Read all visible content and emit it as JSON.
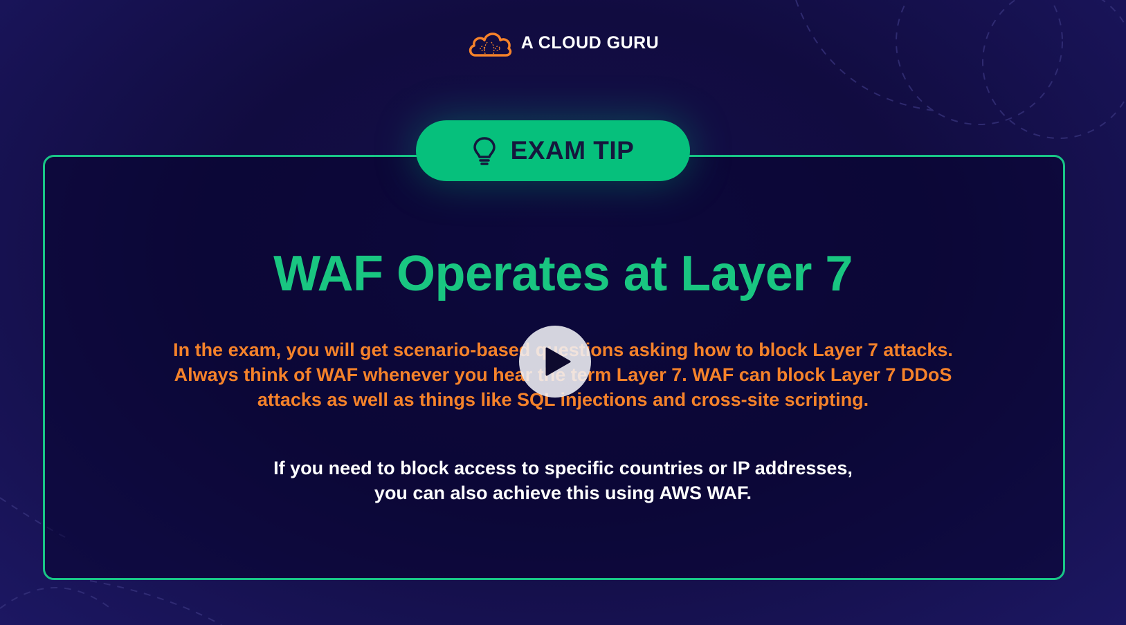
{
  "brand": {
    "name": "A CLOUD GURU",
    "logo_icon": "cloud-logo-icon",
    "logo_color": "#f5822a"
  },
  "tip": {
    "label": "EXAM TIP",
    "icon": "lightbulb-icon",
    "color": "#06c07c"
  },
  "slide": {
    "title": "WAF Operates at Layer 7",
    "paragraph1_lines": [
      "In the exam, you will get scenario-based questions asking how to block Layer 7 attacks.",
      "Always think of WAF whenever you hear the term Layer 7. WAF can block Layer 7 DDoS",
      "attacks as well as things like SQL injections and cross-site scripting."
    ],
    "paragraph2_lines": [
      "If you need to block access to specific countries or IP addresses,",
      "you can also achieve this using AWS WAF."
    ]
  },
  "player": {
    "play_icon": "play-icon"
  },
  "colors": {
    "background": "#110c40",
    "accent_green": "#19c687",
    "accent_orange": "#f5822a",
    "text_white": "#ffffff"
  }
}
